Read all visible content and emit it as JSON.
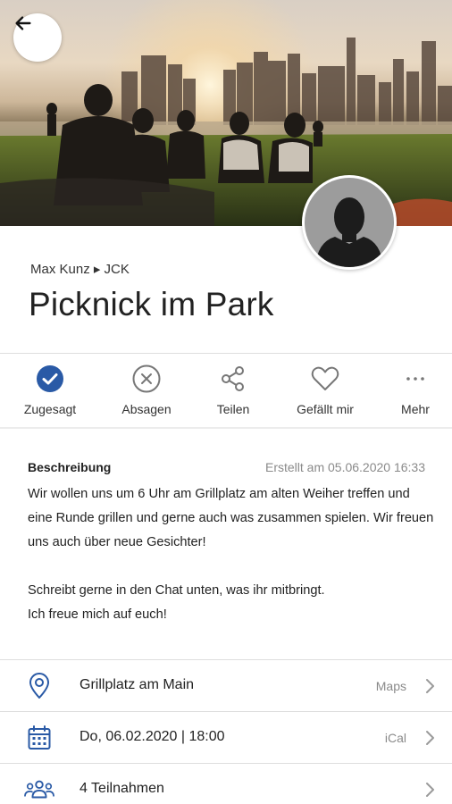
{
  "event": {
    "organizer": "Max Kunz ▸ JCK",
    "title": "Picknick im Park"
  },
  "actions": [
    {
      "label": "Zugesagt",
      "icon": "check-circle-icon",
      "active": true
    },
    {
      "label": "Absagen",
      "icon": "x-circle-icon",
      "active": false
    },
    {
      "label": "Teilen",
      "icon": "share-icon",
      "active": false
    },
    {
      "label": "Gefällt mir",
      "icon": "heart-icon",
      "active": false
    },
    {
      "label": "Mehr",
      "icon": "more-icon",
      "active": false
    }
  ],
  "description": {
    "heading": "Beschreibung",
    "created": "Erstellt am 05.06.2020 16:33",
    "body": "Wir wollen uns um 6 Uhr am Grillplatz am alten Weiher treffen und eine Runde grillen und gerne auch was zusammen spielen. Wir freuen uns auch über neue Gesichter!\n\nSchreibt gerne in den Chat unten, was ihr mitbringt.\nIch freue mich auf euch!"
  },
  "info": {
    "location": {
      "text": "Grillplatz am Main",
      "aux": "Maps",
      "icon": "map-pin-icon"
    },
    "date": {
      "text": "Do, 06.02.2020 | 18:00",
      "aux": "iCal",
      "icon": "calendar-icon"
    },
    "participants": {
      "text": "4 Teilnahmen",
      "aux": "",
      "icon": "people-icon"
    }
  },
  "colors": {
    "accent": "#2a5aa6",
    "icon_gray": "#777777",
    "text": "#222222",
    "muted": "#8a8a8a"
  }
}
